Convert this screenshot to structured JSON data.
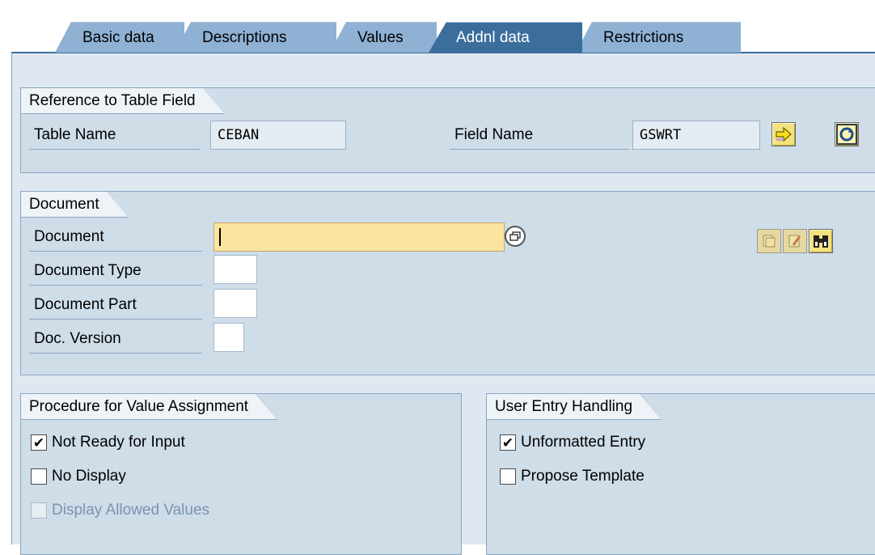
{
  "tabs": [
    {
      "label": "Basic data",
      "active": false
    },
    {
      "label": "Descriptions",
      "active": false
    },
    {
      "label": "Values",
      "active": false
    },
    {
      "label": "Addnl data",
      "active": true
    },
    {
      "label": "Restrictions",
      "active": false
    }
  ],
  "reference": {
    "title": "Reference to Table Field",
    "table_name_label": "Table Name",
    "table_name_value": "CEBAN",
    "field_name_label": "Field Name",
    "field_name_value": "GSWRT"
  },
  "document": {
    "title": "Document",
    "document_label": "Document",
    "document_value": "",
    "document_type_label": "Document Type",
    "document_type_value": "",
    "document_part_label": "Document Part",
    "document_part_value": "",
    "doc_version_label": "Doc. Version",
    "doc_version_value": ""
  },
  "procedure": {
    "title": "Procedure for Value Assignment",
    "not_ready_label": "Not Ready for Input",
    "not_ready_checked": true,
    "no_display_label": "No Display",
    "no_display_checked": false,
    "display_allowed_label": "Display Allowed Values",
    "display_allowed_checked": false
  },
  "user_entry": {
    "title": "User Entry Handling",
    "unformatted_label": "Unformatted Entry",
    "unformatted_checked": true,
    "propose_label": "Propose Template",
    "propose_checked": false
  },
  "colors": {
    "active_tab": "#3c6e9c",
    "inactive_tab": "#8fb1d3",
    "panel_bg": "#dfe8f1",
    "group_bg": "#cfdde9",
    "required_field": "#fbe4a0"
  },
  "icons": {
    "forward": "arrow-right-icon",
    "refresh": "refresh-icon",
    "possible_entries": "window-icon",
    "create": "create-document-icon",
    "change": "change-document-icon",
    "display": "binoculars-icon"
  }
}
